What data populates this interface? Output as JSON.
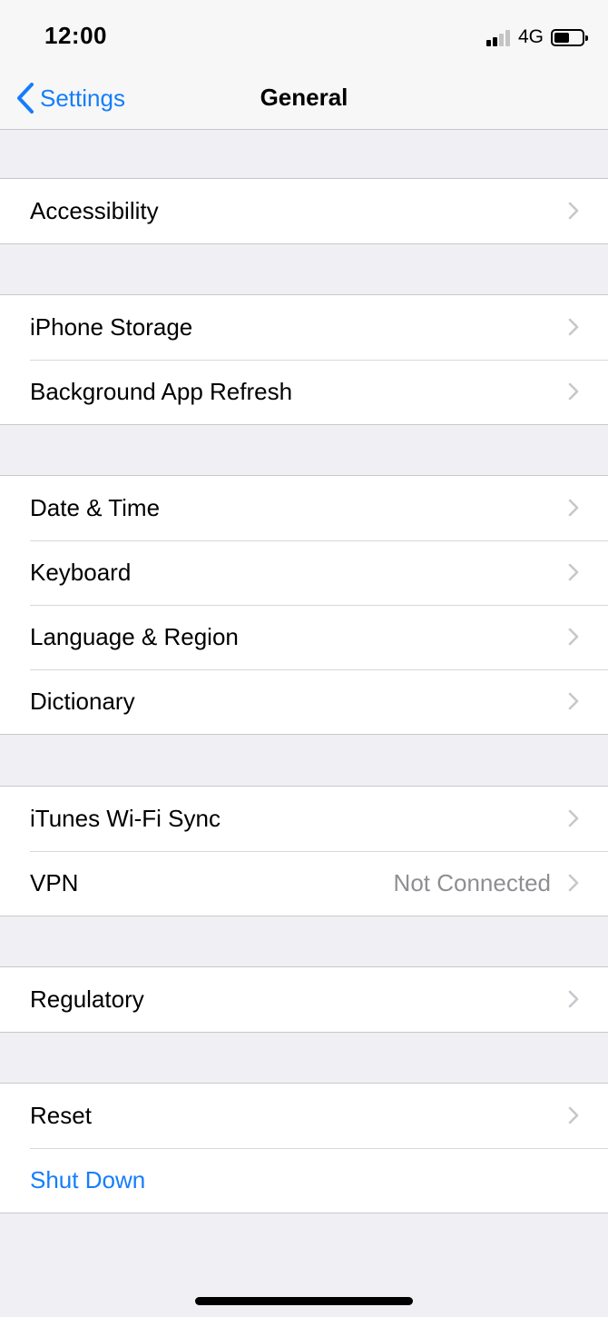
{
  "status_bar": {
    "time": "12:00",
    "network": "4G",
    "signal_bars_active": 2,
    "signal_bars_total": 4,
    "battery_level": 0.55
  },
  "nav": {
    "back_label": "Settings",
    "title": "General"
  },
  "groups": [
    {
      "rows": [
        {
          "label": "Accessibility",
          "chevron": true
        }
      ]
    },
    {
      "rows": [
        {
          "label": "iPhone Storage",
          "chevron": true
        },
        {
          "label": "Background App Refresh",
          "chevron": true
        }
      ]
    },
    {
      "rows": [
        {
          "label": "Date & Time",
          "chevron": true
        },
        {
          "label": "Keyboard",
          "chevron": true
        },
        {
          "label": "Language & Region",
          "chevron": true
        },
        {
          "label": "Dictionary",
          "chevron": true
        }
      ]
    },
    {
      "rows": [
        {
          "label": "iTunes Wi-Fi Sync",
          "chevron": true
        },
        {
          "label": "VPN",
          "detail": "Not Connected",
          "chevron": true
        }
      ]
    },
    {
      "rows": [
        {
          "label": "Regulatory",
          "chevron": true
        }
      ]
    },
    {
      "rows": [
        {
          "label": "Reset",
          "chevron": true
        },
        {
          "label": "Shut Down",
          "chevron": false,
          "style": "link"
        }
      ]
    }
  ],
  "colors": {
    "accent": "#147efb",
    "background": "#efeff4",
    "separator": "#c8c7cc",
    "chevron": "#c7c7cc",
    "detail_text": "#8e8e93"
  }
}
